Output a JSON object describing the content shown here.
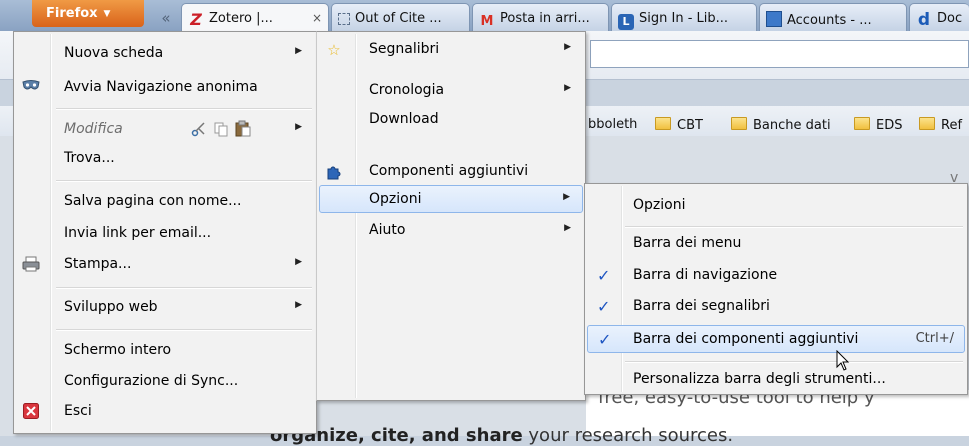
{
  "tabbar": {
    "firefox_label": "Firefox",
    "tabs": [
      {
        "label": "Zotero |...",
        "close": "×"
      },
      {
        "label": "Out of Cite ..."
      },
      {
        "label": "Posta in arri..."
      },
      {
        "label": "Sign In - Lib..."
      },
      {
        "label": "Accounts - ..."
      },
      {
        "label": "Doc"
      }
    ]
  },
  "bookmarks": {
    "partial": "bboleth",
    "items": [
      "CBT",
      "Banche dati",
      "EDS",
      "Ref"
    ]
  },
  "page": {
    "edge_char": "v",
    "line1": "free, easy-to-use tool to help y",
    "line2_bold": "organize, cite, and share",
    "line2_rest": " your research sources."
  },
  "menu_main": {
    "new_tab": "Nuova scheda",
    "private": "Avvia Navigazione anonima",
    "edit": "Modifica",
    "find": "Trova...",
    "save_page": "Salva pagina con nome...",
    "email_link": "Invia link per email...",
    "print": "Stampa...",
    "web_dev": "Sviluppo web",
    "fullscreen": "Schermo intero",
    "sync": "Configurazione di Sync...",
    "exit": "Esci"
  },
  "menu_right": {
    "bookmarks": "Segnalibri",
    "history": "Cronologia",
    "downloads": "Download",
    "addons": "Componenti aggiuntivi",
    "options": "Opzioni",
    "help": "Aiuto"
  },
  "menu_options": {
    "options": "Opzioni",
    "menu_bar": "Barra dei menu",
    "nav_bar": "Barra di navigazione",
    "bookmarks_bar": "Barra dei segnalibri",
    "addons_bar": "Barra dei componenti aggiuntivi",
    "addons_bar_shortcut": "Ctrl+/",
    "customize": "Personalizza barra degli strumenti...",
    "check_glyph": "✓"
  },
  "colors": {
    "firefox_button": "#e87a2c",
    "menu_background": "#f2f2f2",
    "highlight_border": "#8eb6ea",
    "check": "#1f56c2"
  }
}
